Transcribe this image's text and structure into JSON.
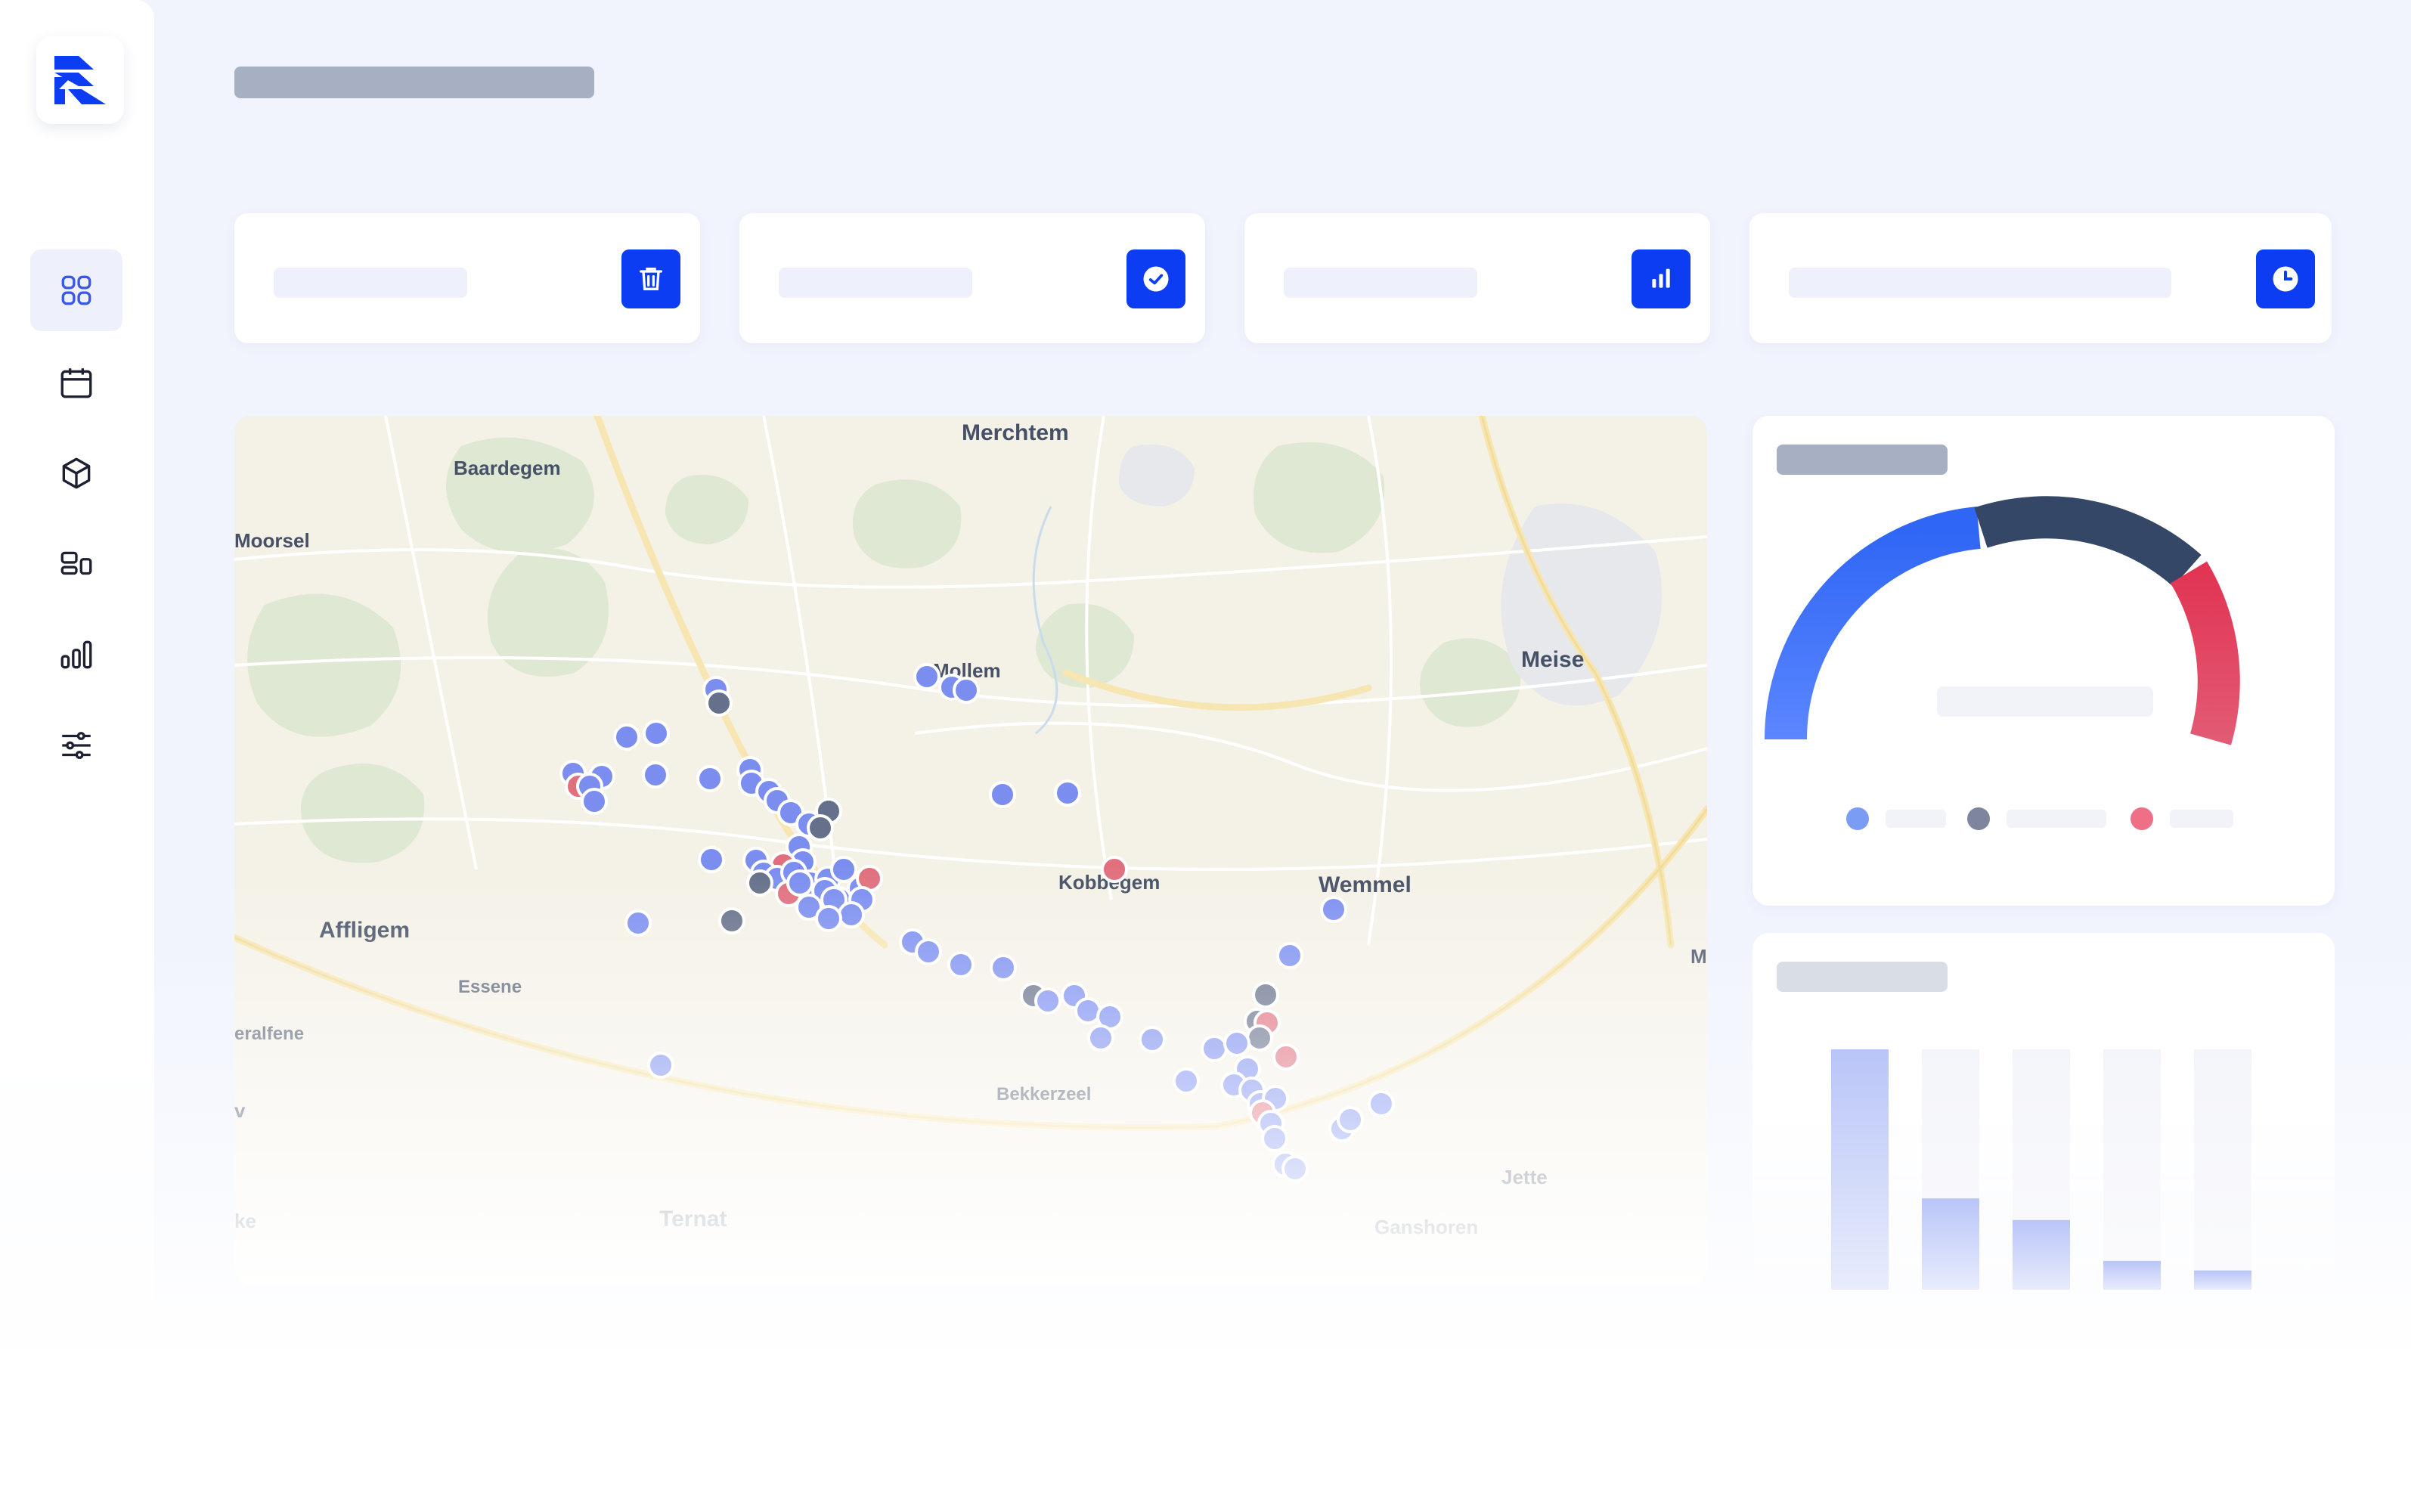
{
  "brand": {
    "logo_icon": "rz-logo-icon",
    "accent": "#0c3df2"
  },
  "sidebar": {
    "items": [
      {
        "name": "dashboard",
        "icon": "grid-icon",
        "active": true
      },
      {
        "name": "calendar",
        "icon": "calendar-icon",
        "active": false
      },
      {
        "name": "inventory",
        "icon": "cube-icon",
        "active": false
      },
      {
        "name": "layout",
        "icon": "layout-icon",
        "active": false
      },
      {
        "name": "reports",
        "icon": "bar-chart-icon",
        "active": false
      },
      {
        "name": "settings",
        "icon": "sliders-icon",
        "active": false
      }
    ]
  },
  "stats": [
    {
      "icon": "trash-icon"
    },
    {
      "icon": "check-circle-icon"
    },
    {
      "icon": "bar-chart-icon"
    },
    {
      "icon": "clock-icon"
    }
  ],
  "map": {
    "places": {
      "merchtem": "Merchtem",
      "baardegem": "Baardegem",
      "moorsel": "Moorsel",
      "meise": "Meise",
      "mollem": "Mollem",
      "kobbegem": "Kobbegem",
      "wemmel": "Wemmel",
      "affligem": "Affligem",
      "essene": "Essene",
      "teralfene": "eralfene",
      "bekkerzeel": "Bekkerzeel",
      "jette": "Jette",
      "ternat": "Ternat",
      "ganshoren": "Ganshoren",
      "edge_m": "M",
      "edge_v": "v",
      "edge_ke": "ke"
    },
    "status_colors": {
      "active": "#7b8ef0",
      "idle": "#66708a",
      "alert": "#e0707e"
    }
  },
  "gauge": {
    "colors": [
      "#3a6ff8",
      "#344766",
      "#e33d5a"
    ],
    "legend_colors": [
      "#7b9cf5",
      "#7d869c",
      "#ef6f86"
    ]
  },
  "bar_chart": {
    "values": [
      1.0,
      0.38,
      0.29,
      0.12,
      0.08
    ]
  }
}
